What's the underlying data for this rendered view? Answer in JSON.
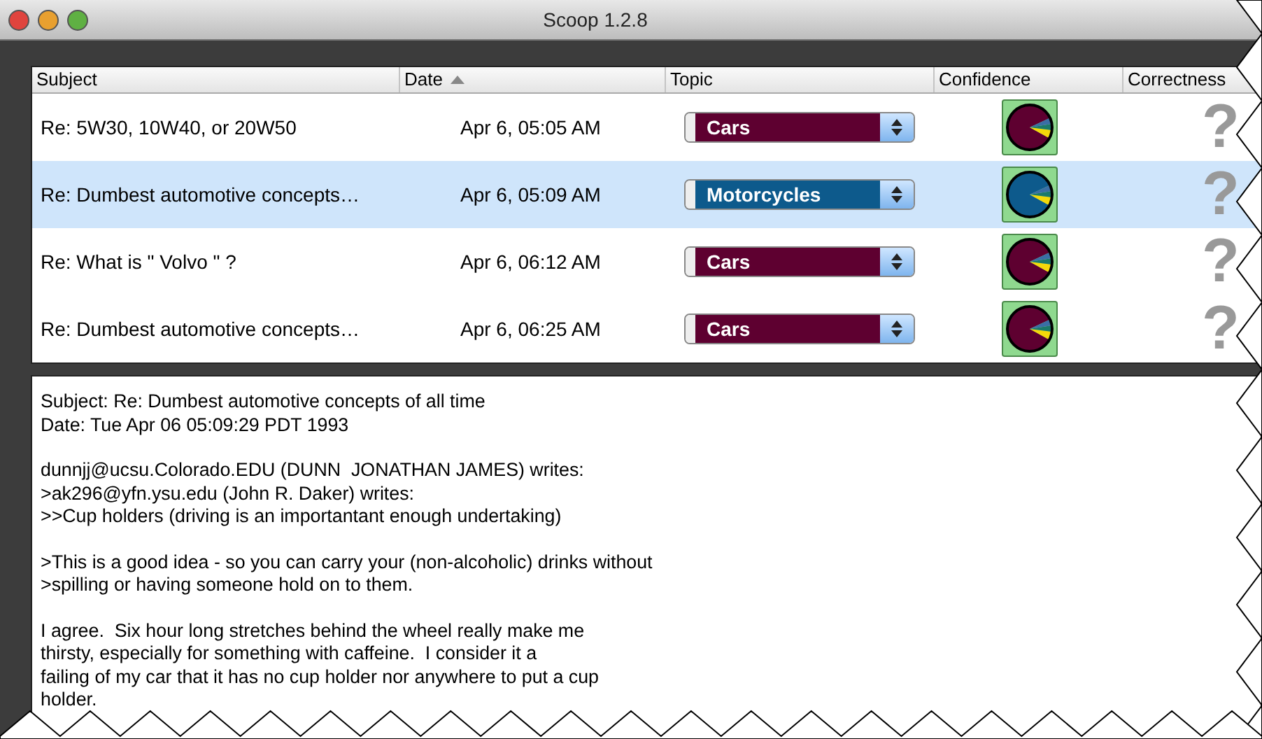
{
  "window": {
    "title": "Scoop 1.2.8"
  },
  "table": {
    "columns": [
      {
        "label": "Subject",
        "sorted": false
      },
      {
        "label": "Date",
        "sorted": true
      },
      {
        "label": "Topic",
        "sorted": false
      },
      {
        "label": "Confidence",
        "sorted": false
      },
      {
        "label": "Correctness",
        "sorted": false
      }
    ],
    "rows": [
      {
        "subject": "Re: 5W30, 10W40, or 20W50",
        "date": "Apr 6, 05:05 AM",
        "topic": "Cars",
        "color": "#5e0030",
        "correctness": "?",
        "selected": false
      },
      {
        "subject": "Re: Dumbest automotive concepts…",
        "date": "Apr 6, 05:09 AM",
        "topic": "Motorcycles",
        "color": "#0d5a8c",
        "correctness": "?",
        "selected": true
      },
      {
        "subject": "Re: What is \" Volvo \" ?",
        "date": "Apr 6, 06:12 AM",
        "topic": "Cars",
        "color": "#5e0030",
        "correctness": "?",
        "selected": false
      },
      {
        "subject": "Re: Dumbest automotive concepts…",
        "date": "Apr 6, 06:25 AM",
        "topic": "Cars",
        "color": "#5e0030",
        "correctness": "?",
        "selected": false
      }
    ]
  },
  "message": {
    "paragraphs": [
      [
        "Subject: Re: Dumbest automotive concepts of all time",
        "Date: Tue Apr 06 05:09:29 PDT 1993"
      ],
      [
        "dunnjj@ucsu.Colorado.EDU (DUNN  JONATHAN JAMES) writes:",
        ">ak296@yfn.ysu.edu (John R. Daker) writes:",
        ">>Cup holders (driving is an importantant enough undertaking)"
      ],
      [
        ">This is a good idea - so you can carry your (non-alcoholic) drinks without",
        ">spilling or having someone hold on to them."
      ],
      [
        "I agree.  Six hour long stretches behind the wheel really make me",
        "thirsty, especially for something with caffeine.  I consider it a",
        "failing of my car that it has no cup holder nor anywhere to put a cup",
        "holder."
      ]
    ]
  }
}
